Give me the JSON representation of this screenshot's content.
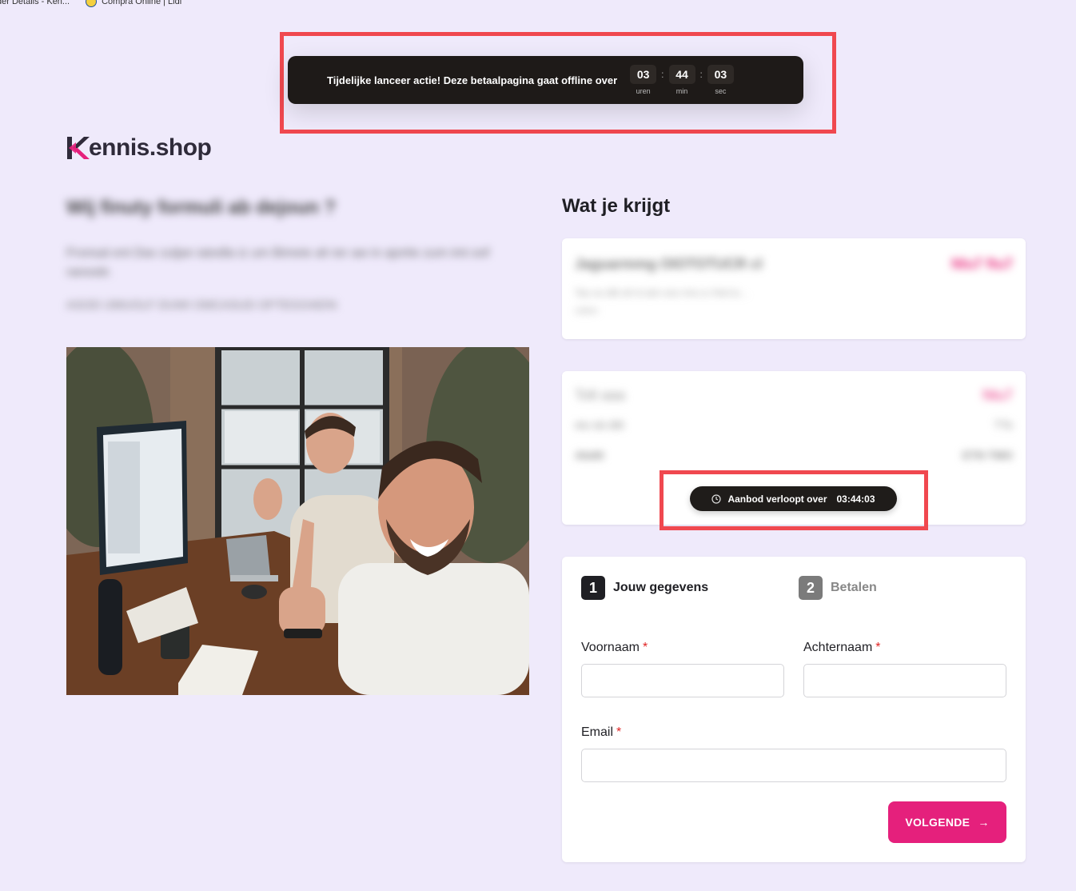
{
  "bookmarks": [
    {
      "label": "der Details - Ken..."
    },
    {
      "label": "Compra Online | Lidl"
    }
  ],
  "top_banner": {
    "text": "Tijdelijke lanceer actie! Deze betaalpagina gaat offline over",
    "hours": "03",
    "hours_label": "uren",
    "minutes": "44",
    "minutes_label": "min",
    "seconds": "03",
    "seconds_label": "sec",
    "separator": ":"
  },
  "logo": {
    "text": "ennis.shop",
    "accent_color": "#e5207c"
  },
  "left": {
    "title": "Wij fi‍nuty fo‍rmuli ab dejoun ?",
    "paragraph": "Fronsal ent Dav zuljan iatodla iz um Bimeie ah ter aw in ajortie zum imt oof ranostir.",
    "paragraph2": "ASOD IJMUOLF DUWI OMCASUD OFTEGOAEIN"
  },
  "right": {
    "title": "Wat je krijgt",
    "product_line": "Jaguarmmg OIOTOTUCR cl",
    "product_price": "Nlu7 ftu7",
    "product_sub": "Tau oo ditt otl nt aim ooo rmo a t lhol tu ..",
    "product_sub2": "cdeio",
    "total_label": "Tolt aaa",
    "total_value": "Ntu7",
    "row2_label": "etu tal dttt",
    "row2_value": "TTo",
    "row3_label": "Abdtt",
    "row3_value": "ETN TMO"
  },
  "offer": {
    "label": "Aanbod verloopt over",
    "time": "03:44:03"
  },
  "form": {
    "step1_num": "1",
    "step1_label": "Jouw gegevens",
    "step2_num": "2",
    "step2_label": "Betalen",
    "first_name_label": "Voornaam",
    "last_name_label": "Achternaam",
    "email_label": "Email",
    "required_mark": "*",
    "first_name_value": "",
    "last_name_value": "",
    "email_value": "",
    "next_label": "VOLGENDE",
    "next_arrow": "→"
  },
  "colors": {
    "background": "#efeafb",
    "accent": "#e5207c",
    "dark": "#1e1a18",
    "annotation": "#f0484f"
  }
}
